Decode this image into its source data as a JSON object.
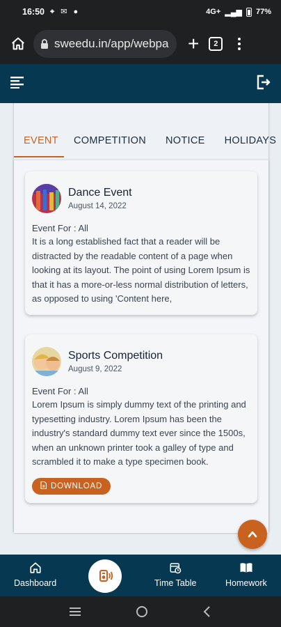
{
  "status_bar": {
    "time": "16:50",
    "battery": "77%",
    "network": "4G+"
  },
  "browser": {
    "url": "sweedu.in/app/webpa",
    "tab_count": "2"
  },
  "tabs": [
    {
      "label": "EVENT",
      "active": true
    },
    {
      "label": "COMPETITION",
      "active": false
    },
    {
      "label": "NOTICE",
      "active": false
    },
    {
      "label": "HOLIDAYS",
      "active": false
    }
  ],
  "cards": [
    {
      "title": "Dance Event",
      "date": "August 14, 2022",
      "event_for": "Event For : All",
      "description": "It is a long established fact that a reader will be distracted by the readable content of a page when looking at its layout. The point of using Lorem Ipsum is that it has a more-or-less normal distribution of letters, as opposed to using 'Content here,"
    },
    {
      "title": "Sports Competition",
      "date": "August 9, 2022",
      "event_for": "Event For : All",
      "description": "Lorem Ipsum is simply dummy text of the printing and typesetting industry. Lorem Ipsum has been the industry's standard dummy text ever since the 1500s, when an unknown printer took a galley of type and scrambled it to make a type specimen book.",
      "download_label": "DOWNLOAD"
    }
  ],
  "bottom_nav": {
    "dashboard": "Dashboard",
    "time_table": "Time Table",
    "homework": "Homework"
  },
  "colors": {
    "primary": "#063851",
    "accent": "#c8621e"
  }
}
